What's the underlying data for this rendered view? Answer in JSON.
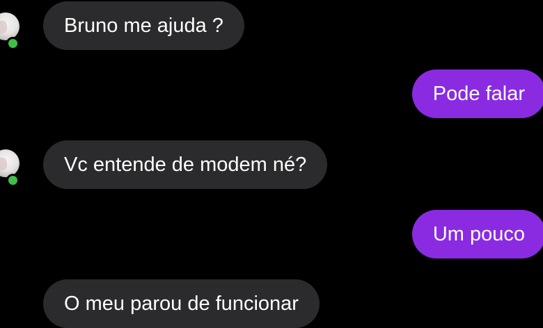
{
  "messages": [
    {
      "direction": "incoming",
      "text": "Bruno me ajuda ?",
      "sender_online": true
    },
    {
      "direction": "outgoing",
      "text": "Pode falar"
    },
    {
      "direction": "incoming",
      "text": "Vc entende de modem né?",
      "sender_online": true
    },
    {
      "direction": "outgoing",
      "text": "Um pouco"
    },
    {
      "direction": "incoming",
      "text": "O meu parou de funcionar",
      "sender_online": false
    }
  ],
  "colors": {
    "background": "#000000",
    "incoming_bubble": "#2b2b2d",
    "outgoing_bubble": "#8a2be2",
    "online_indicator": "#3fbf4a",
    "text": "#ffffff"
  }
}
